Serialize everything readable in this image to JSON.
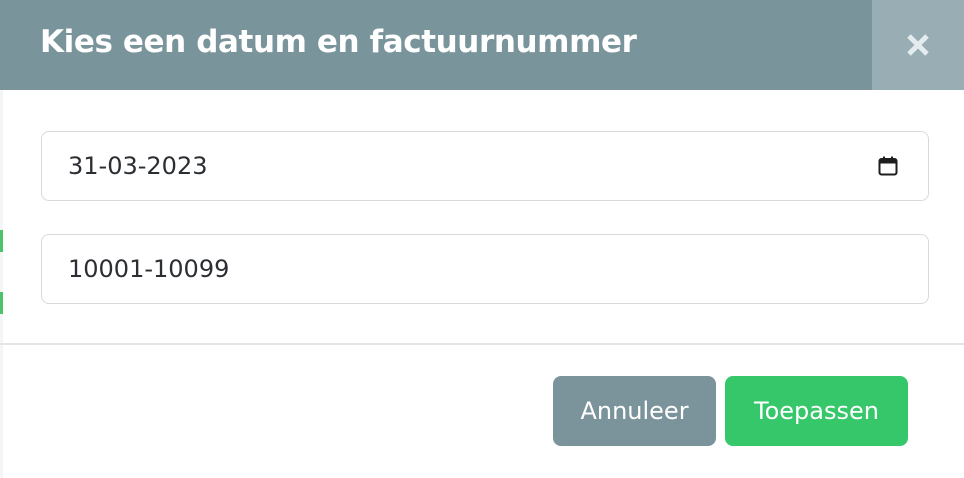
{
  "dialog": {
    "title": "Kies een datum en factuurnummer",
    "close_icon": "close-icon",
    "date_field": {
      "value": "31-03-2023",
      "icon": "calendar-icon"
    },
    "invoice_field": {
      "value": "10001-10099"
    },
    "buttons": {
      "cancel_label": "Annuleer",
      "apply_label": "Toepassen"
    }
  },
  "colors": {
    "header_bg": "#7a949c",
    "close_bg": "#98aeb4",
    "cancel_bg": "#7b939b",
    "apply_bg": "#35c76a",
    "backdrop_accent": "#4cc36a"
  }
}
